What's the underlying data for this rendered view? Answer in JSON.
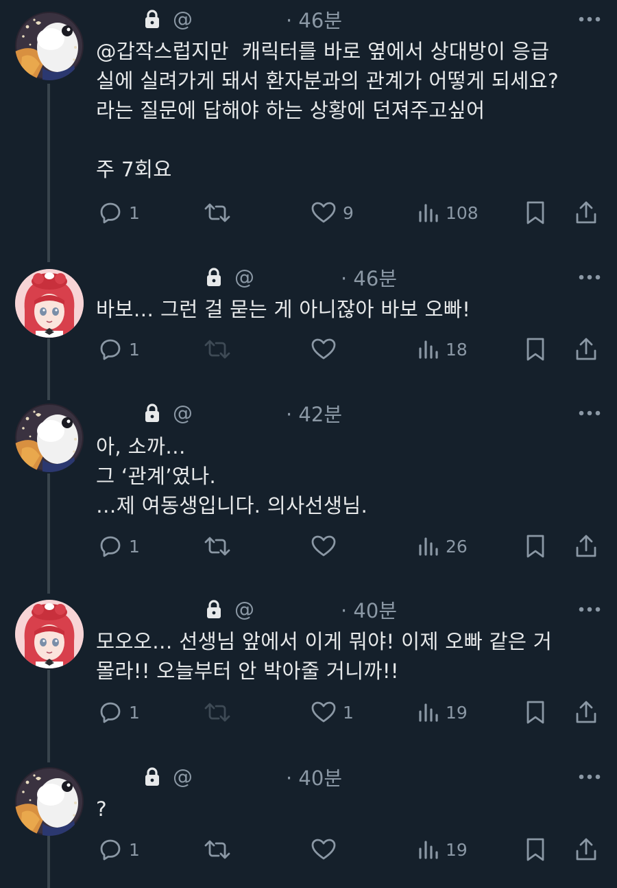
{
  "tweets": [
    {
      "handle": "@",
      "time": "· 46분",
      "text": "@갑작스럽지만  캐릭터를 바로 옆에서 상대방이 응급\n실에 실려가게 돼서 환자분과의 관계가 어떻게 되세요?\n라는 질문에 답해야 하는 상황에 던져주고싶어\n\n주 7회요",
      "replies": "1",
      "retweets": "",
      "likes": "9",
      "views": "108",
      "avatar": "duck",
      "retweet_disabled": false
    },
    {
      "handle": "@",
      "time": "· 46분",
      "text": "바보… 그런 걸 묻는 게 아니잖아 바보 오빠!",
      "replies": "1",
      "retweets": "",
      "likes": "",
      "views": "18",
      "avatar": "redhair",
      "retweet_disabled": true
    },
    {
      "handle": "@",
      "time": "· 42분",
      "text": "아, 소까…\n그 ‘관계’였나.\n…제 여동생입니다. 의사선생님.",
      "replies": "1",
      "retweets": "",
      "likes": "",
      "views": "26",
      "avatar": "duck",
      "retweet_disabled": false
    },
    {
      "handle": "@",
      "time": "· 40분",
      "text": "모오오… 선생님 앞에서 이게 뭐야! 이제 오빠 같은 거\n몰라!! 오늘부터 안 박아줄 거니까!!",
      "replies": "1",
      "retweets": "",
      "likes": "1",
      "views": "19",
      "avatar": "redhair",
      "retweet_disabled": true
    },
    {
      "handle": "@",
      "time": "· 40분",
      "text": "?",
      "replies": "1",
      "retweets": "",
      "likes": "",
      "views": "19",
      "avatar": "duck",
      "retweet_disabled": false
    }
  ],
  "icons": {
    "reply": "reply-icon",
    "retweet": "retweet-icon",
    "like": "like-icon",
    "views": "views-icon",
    "bookmark": "bookmark-icon",
    "share": "share-icon",
    "lock": "lock-icon",
    "more": "more-icon"
  },
  "colors": {
    "background": "#15202b",
    "text": "#e7e9ea",
    "muted": "#8b98a5",
    "thread_line": "#38444d",
    "disabled": "#3e4a55"
  }
}
